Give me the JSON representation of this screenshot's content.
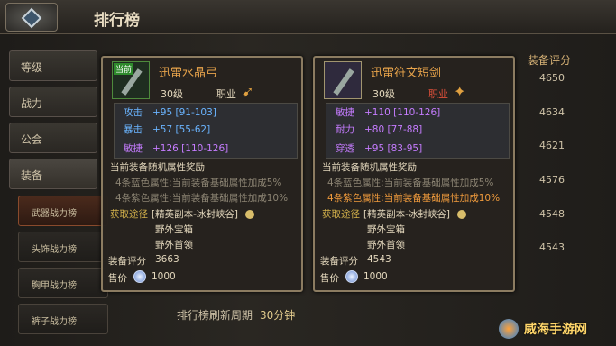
{
  "header": {
    "title": "排行榜"
  },
  "sidebar": {
    "items": [
      "等级",
      "战力",
      "公会",
      "装备"
    ],
    "subitems": [
      "武器战力榜",
      "头饰战力榜",
      "胸甲战力榜",
      "裤子战力榜"
    ]
  },
  "ranking": {
    "score_header": "装备评分",
    "scores": [
      "4650",
      "4634",
      "4621",
      "4576",
      "4548",
      "4543"
    ],
    "refresh_label": "排行榜刷新周期",
    "refresh_value": "30分钟"
  },
  "tooltip_left": {
    "tag": "当前",
    "name": "迅雷水晶弓",
    "level": "30级",
    "job_label": "职业",
    "stats": [
      {
        "key": "攻击",
        "value": "+95 [91-103]",
        "color": "blue"
      },
      {
        "key": "暴击",
        "value": "+57 [55-62]",
        "color": "blue"
      },
      {
        "key": "敏捷",
        "value": "+126 [110-126]",
        "color": "purple"
      }
    ],
    "bonus_title": "当前装备随机属性奖励",
    "bonus_lines": [
      "4条蓝色属性:当前装备基础属性加成5%",
      "4条紫色属性:当前装备基础属性加成10%"
    ],
    "source_label": "获取途径",
    "sources": [
      "[精英副本-冰封峡谷]",
      "野外宝箱",
      "野外首领"
    ],
    "score_label": "装备评分",
    "score_value": "3663",
    "price_label": "售价",
    "price_value": "1000"
  },
  "tooltip_right": {
    "name": "迅雷符文短剑",
    "level": "30级",
    "job_label": "职业",
    "stats": [
      {
        "key": "敏捷",
        "value": "+110 [110-126]",
        "color": "purple"
      },
      {
        "key": "耐力",
        "value": "+80 [77-88]",
        "color": "purple"
      },
      {
        "key": "穿透",
        "value": "+95 [83-95]",
        "color": "purple"
      }
    ],
    "bonus_title": "当前装备随机属性奖励",
    "bonus_lines": [
      "4条蓝色属性:当前装备基础属性加成5%",
      "4条紫色属性:当前装备基础属性加成10%"
    ],
    "source_label": "获取途径",
    "sources": [
      "[精英副本-冰封峡谷]",
      "野外宝箱",
      "野外首领"
    ],
    "score_label": "装备评分",
    "score_value": "4543",
    "price_label": "售价",
    "price_value": "1000"
  },
  "watermark": "威海手游网"
}
